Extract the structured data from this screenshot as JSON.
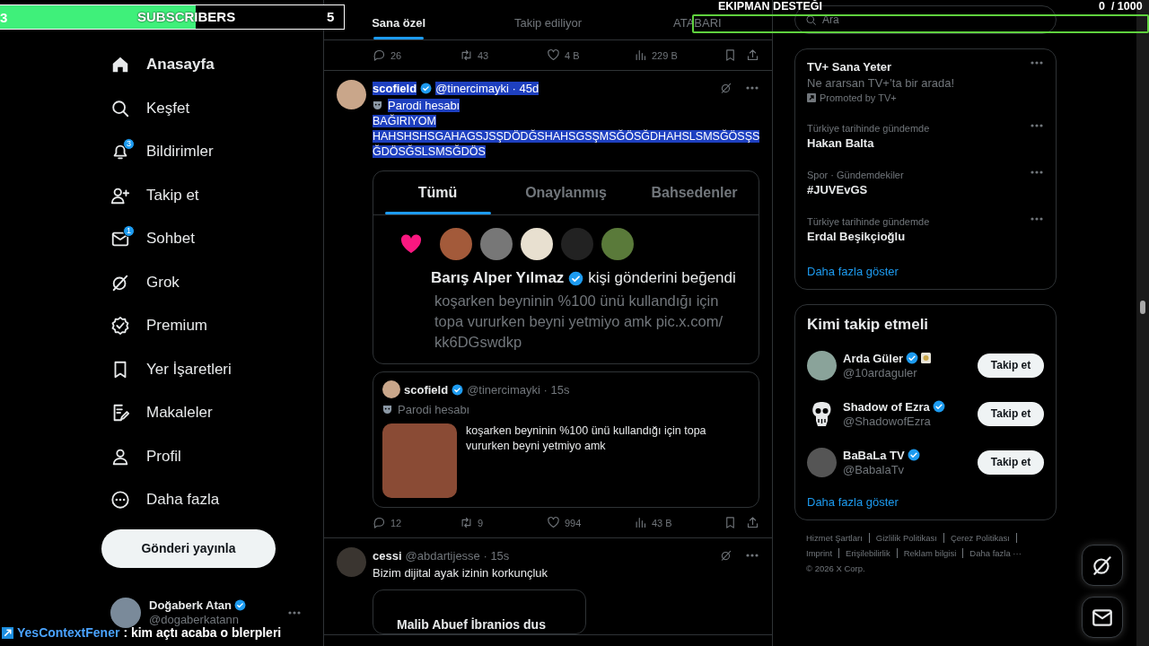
{
  "overlays": {
    "subscribers": {
      "count": "3",
      "label": "SUBSCRIBERS",
      "goal": "5",
      "level": 0.58
    },
    "equipment": {
      "label": "EKIPMAN DESTEĞI",
      "reading": "0  / 1000",
      "level": 0
    },
    "chat": {
      "user": "YesContextFener",
      "message": ": kim açtı acaba o blerpleri"
    }
  },
  "nav": {
    "items": [
      {
        "label": "Anasayfa",
        "selected": true
      },
      {
        "label": "Keşfet",
        "selected": false
      },
      {
        "label": "Bildirimler",
        "selected": false,
        "badge": "3"
      },
      {
        "label": "Takip et",
        "selected": false
      },
      {
        "label": "Sohbet",
        "selected": false,
        "badge": "1"
      },
      {
        "label": "Grok",
        "selected": false
      },
      {
        "label": "Premium",
        "selected": false
      },
      {
        "label": "Yer İşaretleri",
        "selected": false
      },
      {
        "label": "Makaleler",
        "selected": false
      },
      {
        "label": "Profil",
        "selected": false
      },
      {
        "label": "Daha fazla",
        "selected": false
      }
    ],
    "post_button": "Gönderi yayınla",
    "account": {
      "name": "Doğaberk Atan",
      "verified": true,
      "handle": "@dogaberkatann"
    }
  },
  "feed": {
    "tabs": [
      {
        "label": "Sana özel",
        "selected": true
      },
      {
        "label": "Takip ediliyor",
        "selected": false
      },
      {
        "label": "ATABARI",
        "selected": false
      }
    ],
    "previous_post_stats": {
      "replies": "26",
      "reposts": "43",
      "likes": "4 B",
      "views": "229 B"
    },
    "posts": [
      {
        "author": "scofield",
        "verified": true,
        "meta": "@tinercimayki · 45d",
        "label": "Parodi hesabı",
        "highlighted": true,
        "text": "BAĞIRIYOM\nHAHSHSHSGAHAGSJSŞDÖDĞSHAHSGSŞMSĞÖSĞDHAHSLSMSĞÖSŞS\nĞDÖSĞSLSMSĞDÖS",
        "screenshot": {
          "tabs": [
            {
              "label": "Tümü",
              "selected": true
            },
            {
              "label": "Onaylanmış",
              "selected": false
            },
            {
              "label": "Bahsedenler",
              "selected": false
            }
          ],
          "liker": "Barış Alper Yılmaz",
          "liker_verified": true,
          "action": "kişi gönderini beğendi",
          "quoted_text": "koşarken beyninin %100 ünü kullandığı için\ntopa vururken beyni yetmiyo amk pic.x.com/\nkk6DGswdkp"
        },
        "quote": {
          "author": "scofield",
          "verified": true,
          "meta": "@tinercimayki · 15s",
          "label": "Parodi hesabı",
          "text": "koşarken beyninin %100 ünü kullandığı için topa vururken beyni yetmiyo amk"
        },
        "stats": {
          "replies": "12",
          "reposts": "9",
          "likes": "994",
          "views": "43 B"
        }
      },
      {
        "author": "cessi",
        "verified": false,
        "meta": "@abdartijesse · 15s",
        "highlighted": false,
        "text": "Bizim dijital ayak izinin korkunçluk",
        "card_text": "Malib Abuef İbranios dus"
      }
    ]
  },
  "sidebar": {
    "search": {
      "placeholder": "Ara"
    },
    "trends": {
      "promoted": {
        "title": "TV+ Sana Yeter",
        "subtitle": "Ne ararsan TV+’ta bir arada!",
        "promoter": "Promoted by TV+"
      },
      "items": [
        {
          "context": "Türkiye tarihinde gündemde",
          "title": "Hakan Balta"
        },
        {
          "context": "Spor · Gündemdekiler",
          "title": "#JUVEvGS"
        },
        {
          "context": "Türkiye tarihinde gündemde",
          "title": "Erdal Beşikçioğlu"
        }
      ],
      "more": "Daha fazla göster"
    },
    "who_to_follow": {
      "title": "Kimi takip etmeli",
      "accounts": [
        {
          "name": "Arda Güler",
          "verified": true,
          "affiliate": true,
          "handle": "@10ardaguler",
          "button": "Takip et",
          "kind": "photo"
        },
        {
          "name": "Shadow of Ezra",
          "verified": true,
          "affiliate": false,
          "handle": "@ShadowofEzra",
          "button": "Takip et",
          "kind": "skull"
        },
        {
          "name": "BaBaLa TV",
          "verified": true,
          "affiliate": false,
          "handle": "@BabalaTv",
          "button": "Takip et",
          "kind": "photo"
        }
      ],
      "more": "Daha fazla göster"
    },
    "footer": {
      "links": [
        "Hizmet Şartları",
        "Gizlilik Politikası",
        "Çerez Politikası",
        "Imprint",
        "Erişilebilirlik",
        "Reklam bilgisi",
        "Daha fazla ···"
      ],
      "copyright": "© 2026 X Corp."
    }
  }
}
